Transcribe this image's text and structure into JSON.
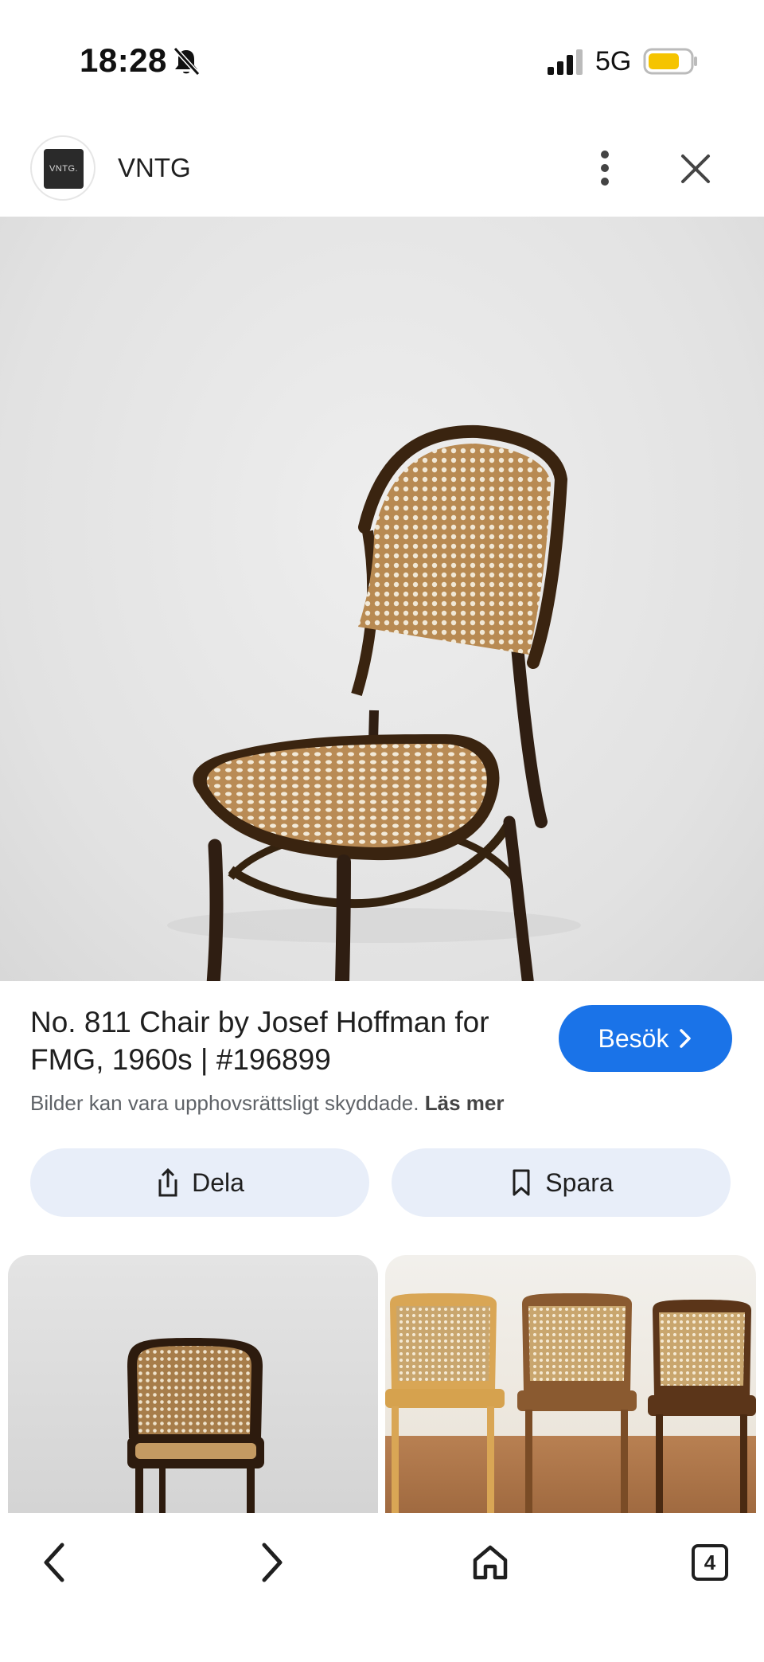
{
  "status_bar": {
    "time": "18:28",
    "network": "5G",
    "battery_color": "#f5c400"
  },
  "header": {
    "site_logo_text": "VNTG.",
    "site_name": "VNTG"
  },
  "main_image": {
    "icon": "chair-photo"
  },
  "result": {
    "title": "No. 811 Chair by Josef Hoffman for FMG, 1960s | #196899",
    "visit_label": "Besök",
    "copyright_text": "Bilder kan vara upphovsrättsligt skyddade.",
    "read_more_label": "Läs mer",
    "share_label": "Dela",
    "save_label": "Spara"
  },
  "bottom_nav": {
    "tab_count": "4"
  },
  "colors": {
    "accent": "#1a73e8",
    "action_bg": "#e8eef9"
  }
}
